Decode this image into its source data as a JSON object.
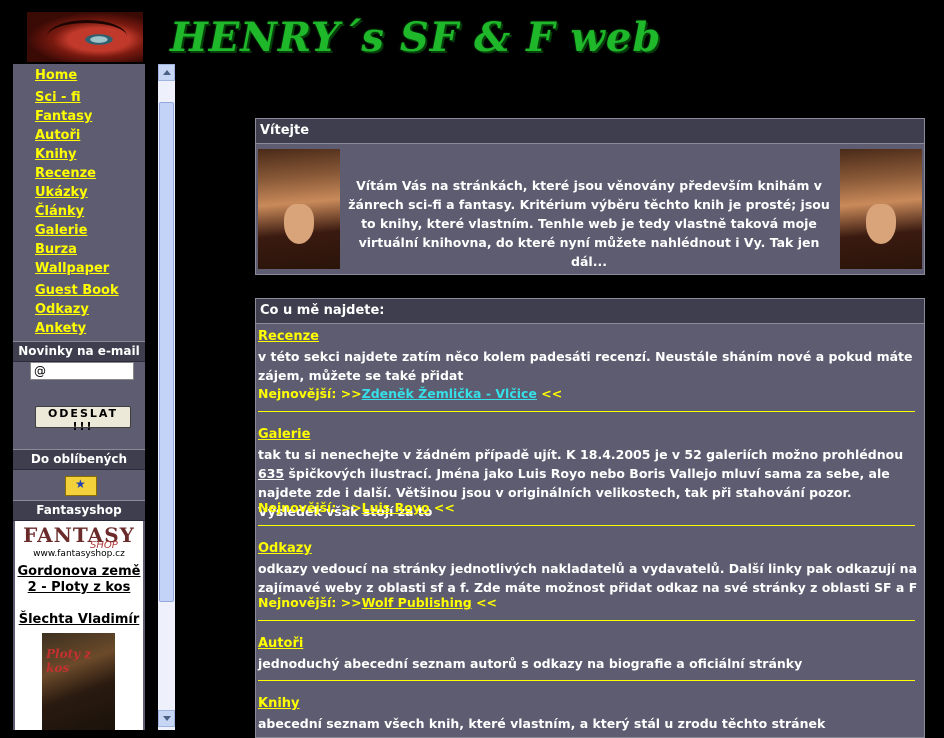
{
  "header": {
    "site_title": "HENRY´s  SF & F web"
  },
  "nav": [
    "Home",
    "Sci - fi",
    "Fantasy",
    "Autoři",
    "Knihy",
    "Recenze",
    "Ukázky",
    "Články",
    "Galerie",
    "Burza",
    "Wallpaper",
    "Guest Book",
    "Odkazy",
    "Ankety"
  ],
  "newsletter": {
    "heading": "Novinky na e-mail",
    "input_value": "@",
    "button_label": "ODESLAT !!!"
  },
  "favorites": {
    "heading": "Do oblíbených",
    "icon": "bookmark-icon"
  },
  "shop": {
    "heading": "Fantasyshop",
    "logo_text": "FANTASY",
    "logo_sub": "SHOP",
    "url": "www.fantasyshop.cz",
    "book_title": "Gordonova země 2 - Ploty z kos",
    "author": "Šlechta Vladimír",
    "cover_text": "Ploty z kos"
  },
  "welcome": {
    "heading": "Vítejte",
    "text": "Vítám Vás na stránkách, které jsou věnovány především knihám v žánrech sci-fi a fantasy. Kritérium výběru těchto knih je prosté; jsou to knihy, které vlastním. Tenhle web je tedy vlastně taková moje virtuální knihovna, do které nyní můžete nahlédnout i Vy. Tak jen dál..."
  },
  "content": {
    "heading": "Co u mě najdete:",
    "newest_prefix": "Nejnovější: >>",
    "newest_suffix": " <<",
    "items": [
      {
        "title": "Recenze",
        "text": "v této sekci najdete zatím něco kolem padesáti recenzí. Neustále sháním nové a pokud máte zájem, můžete se také přidat",
        "newest": "Zdeněk Žemlička - Vlčice"
      },
      {
        "title": "Galerie",
        "text_before": "tak tu si nenechejte v žádném případě ujít. K 18.4.2005 je v 52 galeriích možno prohlédnou ",
        "count": "635",
        "text_after": " špičkových ilustrací. Jména jako Luis Royo nebo Boris Vallejo mluví sama za sebe, ale najdete zde i další. Většinou jsou v originálních velikostech, tak při stahování pozor. Výsledek však stojí za to",
        "newest": "Luis Royo"
      },
      {
        "title": "Odkazy",
        "text": "odkazy vedoucí na stránky jednotlivých nakladatelů a vydavatelů. Další linky pak odkazují na zajímavé weby z oblasti sf a f. Zde máte možnost přidat odkaz na své stránky z oblasti SF a F",
        "newest": "Wolf Publishing"
      },
      {
        "title": "Autoři",
        "text": "jednoduchý abecední seznam autorů s odkazy na biografie a oficiální stránky"
      },
      {
        "title": "Knihy",
        "text": "abecední seznam všech knih, které vlastním, a který stál u zrodu těchto stránek"
      }
    ]
  },
  "colors": {
    "background": "#000000",
    "panel": "#5e5c70",
    "panel_head": "#3f3e4e",
    "link": "#ffff00",
    "link_active": "#35e0e8",
    "title_green": "#1fb82a"
  }
}
